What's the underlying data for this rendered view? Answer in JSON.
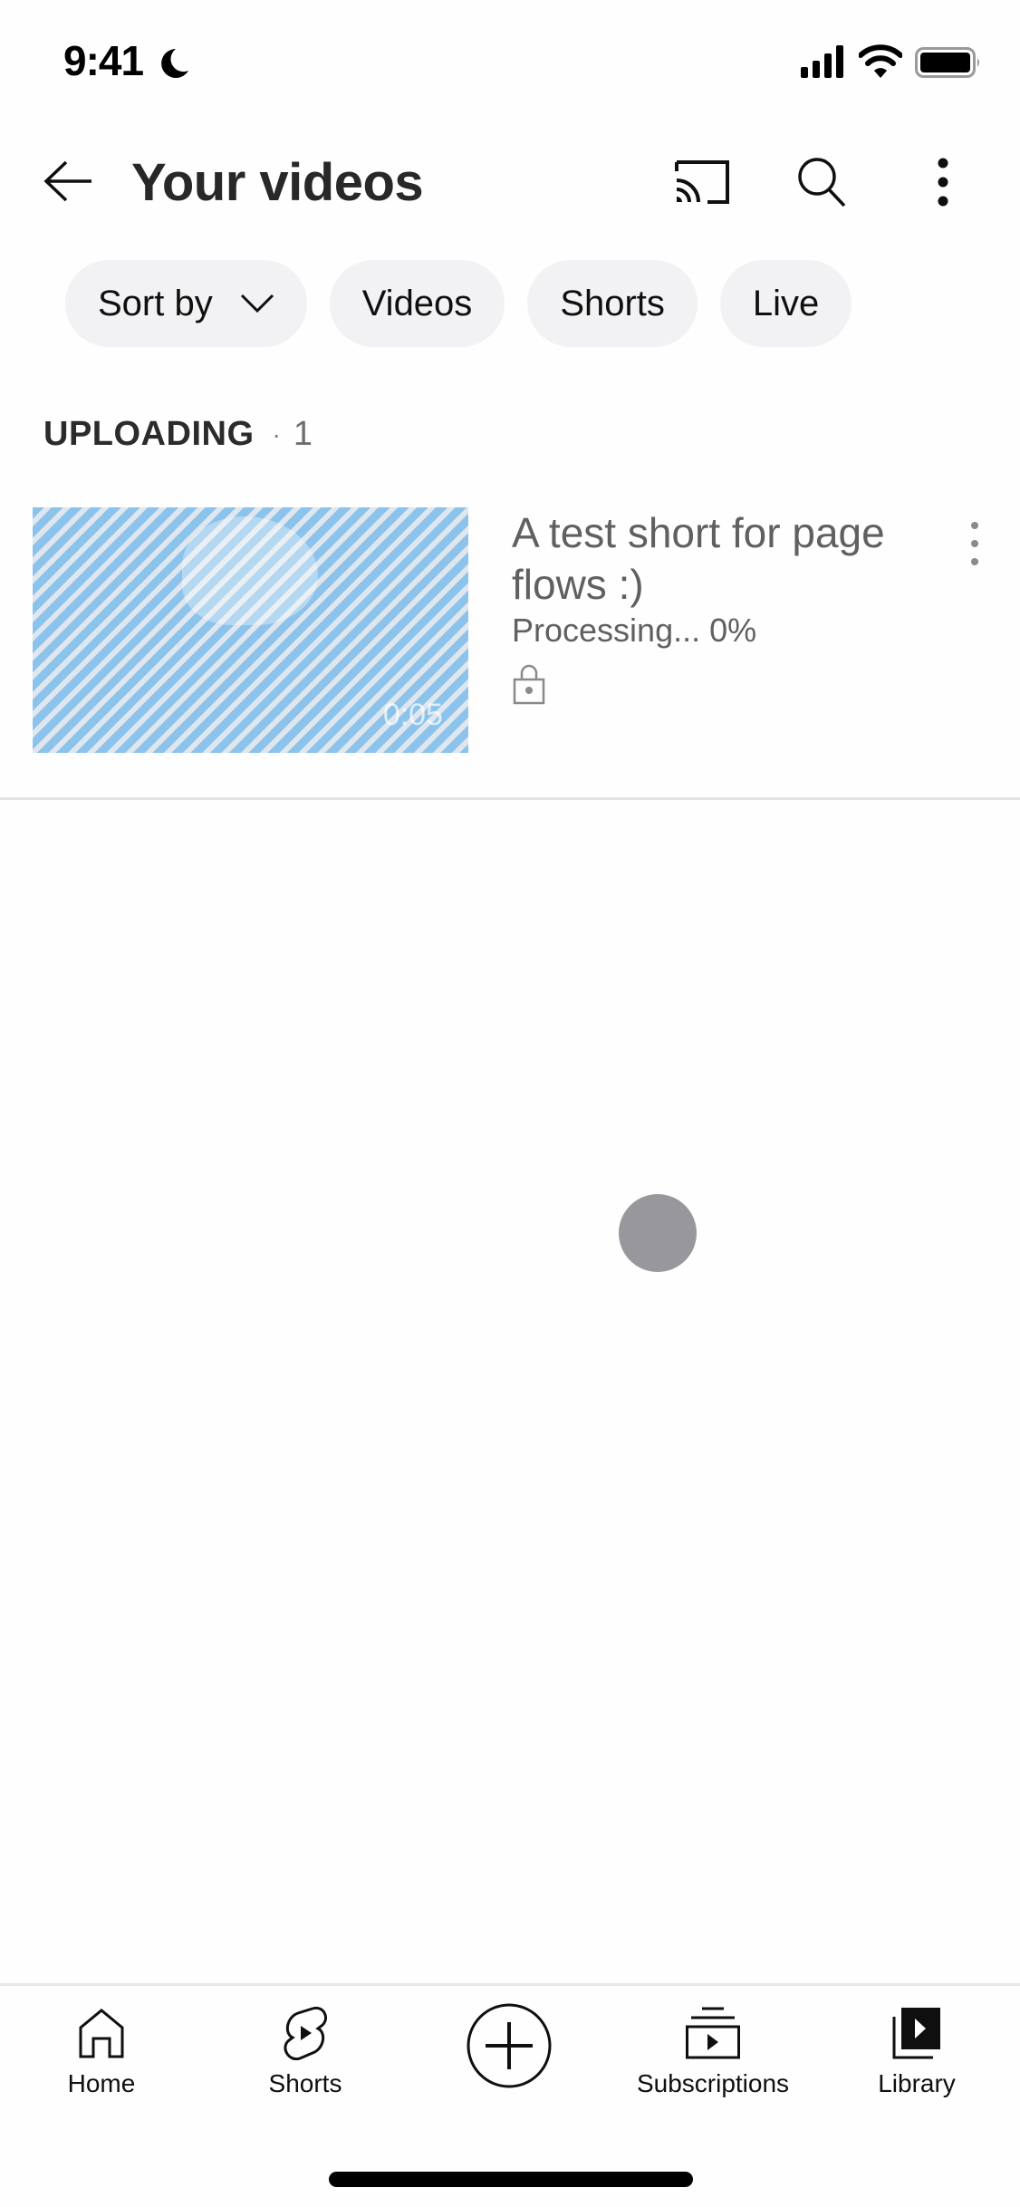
{
  "status_bar": {
    "time": "9:41",
    "icons": [
      "moon-icon",
      "cellular-signal-icon",
      "wifi-icon",
      "battery-icon"
    ]
  },
  "header": {
    "title": "Your videos",
    "icons": {
      "back": "arrow-left-icon",
      "cast": "cast-icon",
      "search": "search-icon",
      "more": "more-vertical-icon"
    }
  },
  "chips": [
    {
      "label": "Sort by",
      "icon": "chevron-down-icon"
    },
    {
      "label": "Videos"
    },
    {
      "label": "Shorts"
    },
    {
      "label": "Live"
    }
  ],
  "section": {
    "label": "UPLOADING",
    "separator": "·",
    "count": "1"
  },
  "videos": [
    {
      "title": "A test short for page flows :)",
      "status": "Processing... 0%",
      "progress_percent": 0,
      "duration": "0:05",
      "visibility": "private",
      "visibility_icon": "lock-icon"
    }
  ],
  "bottom_nav": [
    {
      "label": "Home",
      "icon": "home-icon"
    },
    {
      "label": "Shorts",
      "icon": "shorts-icon"
    },
    {
      "label": "",
      "icon": "create-plus-icon"
    },
    {
      "label": "Subscriptions",
      "icon": "subscriptions-icon"
    },
    {
      "label": "Library",
      "icon": "library-icon",
      "active": true
    }
  ],
  "colors": {
    "chip_bg": "#f2f2f4",
    "secondary_text": "#606060",
    "title_text": "#282828",
    "thumbnail_stripe": "#8cc3ec",
    "touch_indicator": "#98979b"
  }
}
